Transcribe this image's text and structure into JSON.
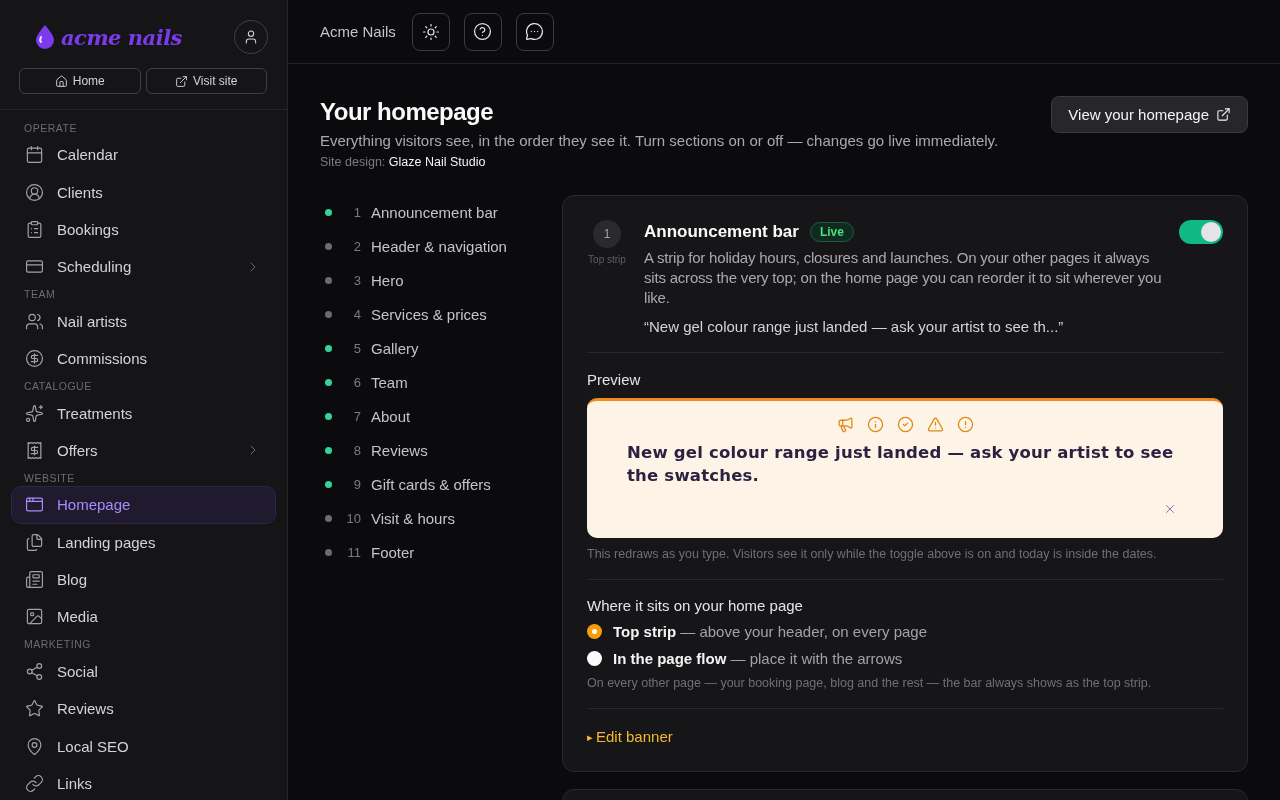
{
  "sidebar": {
    "logo": "acme nails",
    "quick_links": [
      {
        "label": "Home"
      },
      {
        "label": "Visit site"
      }
    ],
    "groups": [
      {
        "heading": "OPERATE",
        "items": [
          {
            "label": "Calendar",
            "expandable": false,
            "selected": false
          },
          {
            "label": "Clients",
            "expandable": false,
            "selected": false
          },
          {
            "label": "Bookings",
            "expandable": false,
            "selected": false
          },
          {
            "label": "Scheduling",
            "expandable": true,
            "selected": false
          }
        ]
      },
      {
        "heading": "TEAM",
        "items": [
          {
            "label": "Nail artists",
            "expandable": false,
            "selected": false
          },
          {
            "label": "Commissions",
            "expandable": false,
            "selected": false
          }
        ]
      },
      {
        "heading": "CATALOGUE",
        "items": [
          {
            "label": "Treatments",
            "expandable": false,
            "selected": false
          },
          {
            "label": "Offers",
            "expandable": true,
            "selected": false
          }
        ]
      },
      {
        "heading": "WEBSITE",
        "items": [
          {
            "label": "Homepage",
            "expandable": false,
            "selected": true
          },
          {
            "label": "Landing pages",
            "expandable": false,
            "selected": false
          },
          {
            "label": "Blog",
            "expandable": false,
            "selected": false
          },
          {
            "label": "Media",
            "expandable": false,
            "selected": false
          }
        ]
      },
      {
        "heading": "MARKETING",
        "items": [
          {
            "label": "Social",
            "expandable": false,
            "selected": false
          },
          {
            "label": "Reviews",
            "expandable": false,
            "selected": false
          },
          {
            "label": "Local SEO",
            "expandable": false,
            "selected": false
          },
          {
            "label": "Links",
            "expandable": false,
            "selected": false
          }
        ]
      }
    ]
  },
  "topbar": {
    "brand": "Acme Nails"
  },
  "page": {
    "title": "Your homepage",
    "subtitle": "Everything visitors see, in the order they see it. Turn sections on or off — changes go live immediately.",
    "design_label": "Site design:",
    "design_name": "Glaze Nail Studio",
    "view_button": "View your homepage"
  },
  "sections": [
    {
      "number": "1",
      "label": "Announcement bar",
      "on": true
    },
    {
      "number": "2",
      "label": "Header & navigation",
      "on": false
    },
    {
      "number": "3",
      "label": "Hero",
      "on": false
    },
    {
      "number": "4",
      "label": "Services & prices",
      "on": false
    },
    {
      "number": "5",
      "label": "Gallery",
      "on": true
    },
    {
      "number": "6",
      "label": "Team",
      "on": true
    },
    {
      "number": "7",
      "label": "About",
      "on": true
    },
    {
      "number": "8",
      "label": "Reviews",
      "on": true
    },
    {
      "number": "9",
      "label": "Gift cards & offers",
      "on": true
    },
    {
      "number": "10",
      "label": "Visit & hours",
      "on": false
    },
    {
      "number": "11",
      "label": "Footer",
      "on": false
    }
  ],
  "section_card": {
    "number": "1",
    "position": "Top strip",
    "title": "Announcement bar",
    "badge": "Live",
    "enabled": true,
    "description": "A strip for holiday hours, closures and launches. On your other pages it always sits across the very top; on the home page you can reorder it to sit wherever you like.",
    "quote": "“New gel colour range just landed — ask your artist to see th...”",
    "preview": {
      "heading": "Preview",
      "text": "New gel colour range just landed — ask your artist to see the swatches.",
      "hint": "This redraws as you type. Visitors see it only while the toggle above is on and today is inside the dates."
    },
    "placement": {
      "heading": "Where it sits on your home page",
      "options": [
        {
          "label": "Top strip",
          "description": "— above your header, on every page",
          "selected": true
        },
        {
          "label": "In the page flow",
          "description": "— place it with the arrows",
          "selected": false
        }
      ],
      "note": "On every other page — your booking page, blog and the rest — the bar always shows as the top strip."
    },
    "edit": {
      "marker": "▸",
      "label": "Edit banner"
    }
  }
}
